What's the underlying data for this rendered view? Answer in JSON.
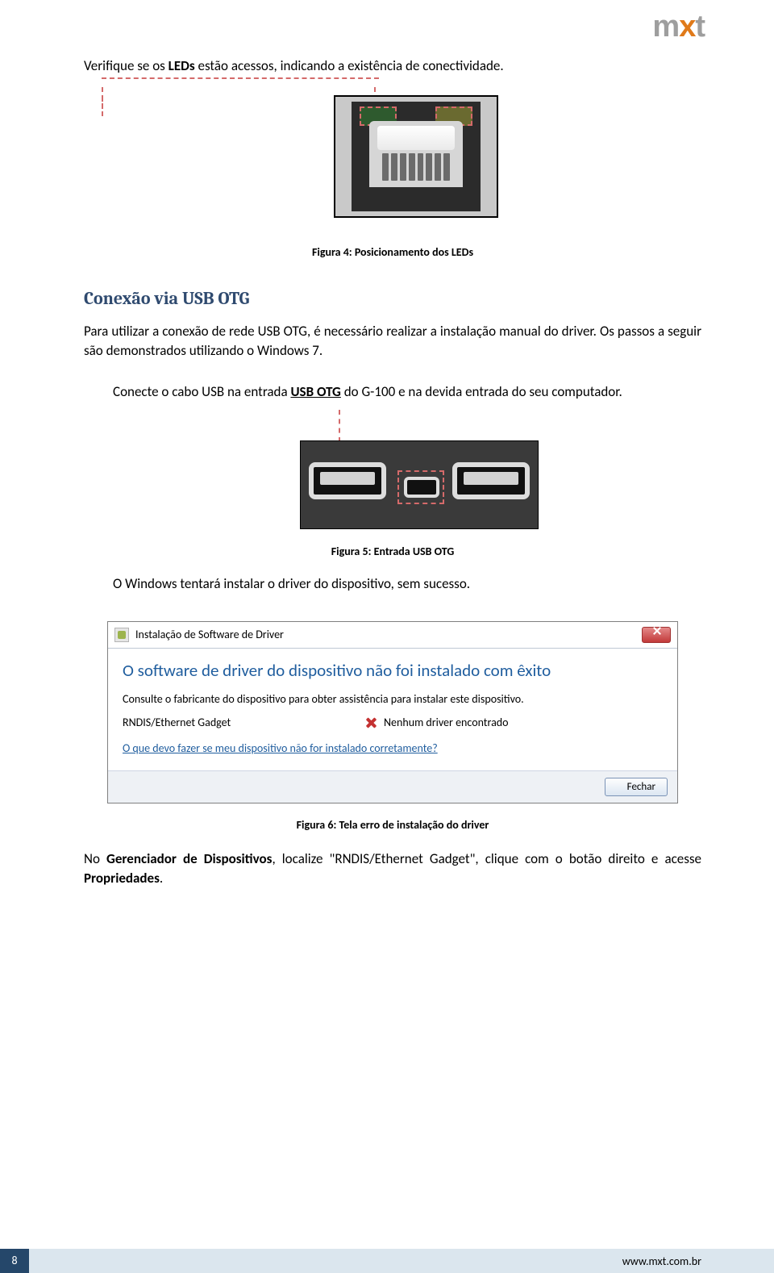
{
  "logo": {
    "m": "m",
    "x": "x",
    "t": "t"
  },
  "intro_before_bold": "Verifique se os ",
  "intro_bold": "LEDs",
  "intro_after_bold": " estão acessos, indicando a existência de conectividade.",
  "caption4": "Figura 4: Posicionamento dos LEDs",
  "heading_usb": "Conexão via USB OTG",
  "para_usb": "Para utilizar a conexão de rede USB OTG, é necessário realizar a instalação manual do driver. Os passos a seguir são demonstrados utilizando o Windows 7.",
  "para_connect_a": "Conecte o cabo USB na entrada ",
  "para_connect_b": "USB OTG",
  "para_connect_c": " do G-100 e na devida entrada do seu computador.",
  "caption5": "Figura 5: Entrada USB OTG",
  "para_windows": "O Windows tentará instalar o driver do dispositivo, sem sucesso.",
  "win7": {
    "title": "Instalação de Software de Driver",
    "heading": "O software de driver do dispositivo não foi instalado com êxito",
    "sub": "Consulte o fabricante do dispositivo para obter assistência para instalar este dispositivo.",
    "device": "RNDIS/Ethernet Gadget",
    "status": "Nenhum driver encontrado",
    "link": "O que devo fazer se meu dispositivo não for instalado corretamente?",
    "close_btn": "Fechar"
  },
  "caption6": "Figura 6: Tela erro de instalação do driver",
  "para4_a": "No ",
  "para4_b": "Gerenciador de Dispositivos",
  "para4_c": ", localize \"RNDIS/Ethernet Gadget\", clique com o botão direito e acesse ",
  "para4_d": "Propriedades",
  "para4_e": ".",
  "footer": {
    "page": "8",
    "url": "www.mxt.com.br"
  }
}
